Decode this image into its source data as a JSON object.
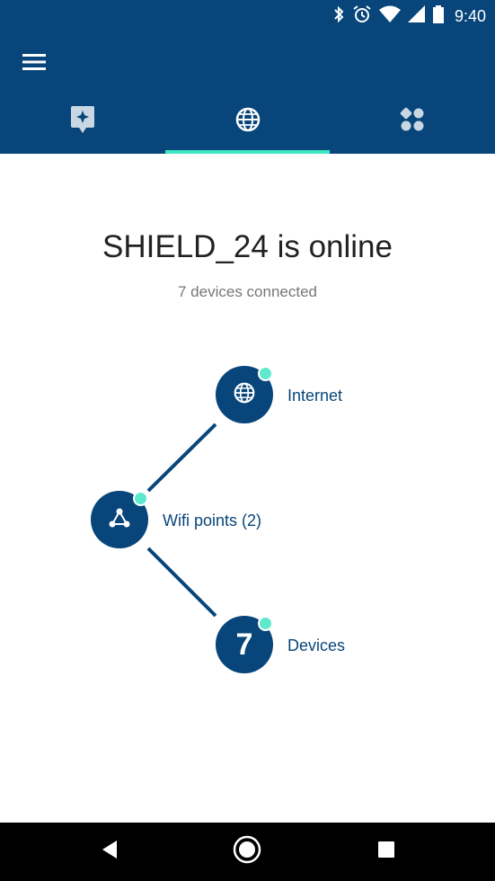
{
  "status_bar": {
    "time": "9:40",
    "icons": [
      "bluetooth-icon",
      "alarm-icon",
      "wifi-icon",
      "signal-icon",
      "battery-icon"
    ]
  },
  "app_bar": {
    "menu_icon": "hamburger-menu-icon",
    "tabs": [
      {
        "icon": "sparkle-badge-icon",
        "selected": false
      },
      {
        "icon": "globe-icon",
        "selected": true
      },
      {
        "icon": "apps-grid-icon",
        "selected": false
      }
    ]
  },
  "main": {
    "title": "SHIELD_24 is online",
    "subtitle": "7 devices connected"
  },
  "diagram": {
    "nodes": [
      {
        "label": "Internet",
        "icon": "globe-icon",
        "status": "online"
      },
      {
        "label": "Wifi points (2)",
        "icon": "network-nodes-icon",
        "status": "online"
      },
      {
        "label": "Devices",
        "value": "7",
        "status": "online"
      }
    ]
  },
  "colors": {
    "primary": "#07457a",
    "accent": "#3ee6c1",
    "status_dot": "#5ee8cc"
  },
  "nav_bar": {
    "buttons": [
      "back-icon",
      "home-icon",
      "recents-icon"
    ]
  }
}
